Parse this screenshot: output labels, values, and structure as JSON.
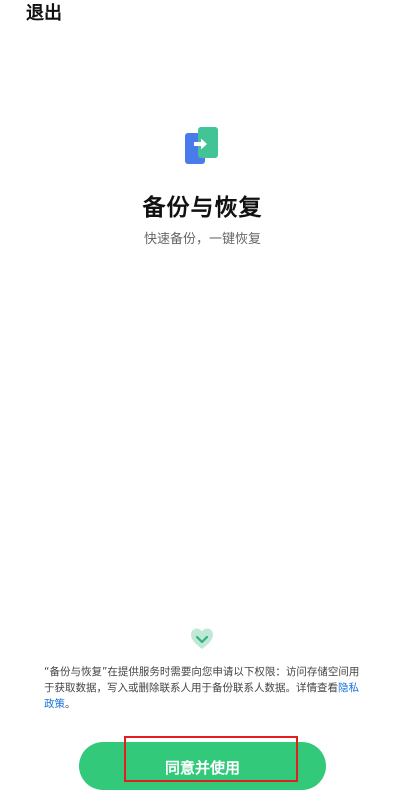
{
  "header": {
    "exit_label": "退出"
  },
  "hero": {
    "title": "备份与恢复",
    "subtitle": "快速备份，一键恢复",
    "icon": "backup-transfer-icon"
  },
  "notice": {
    "text": "“备份与恢复”在提供服务时需要向您申请以下权限：访问存储空间用于获取数据，写入或删除联系人用于备份联系人数据。详情查看",
    "link": "隐私政策",
    "suffix": "。",
    "badge_icon": "privacy-heart-icon"
  },
  "actions": {
    "agree_label": "同意并使用"
  },
  "colors": {
    "accent": "#33c97a",
    "icon_blue": "#4a7bea",
    "icon_teal": "#42c497",
    "link": "#1a73d9",
    "highlight_box": "#e02020"
  }
}
